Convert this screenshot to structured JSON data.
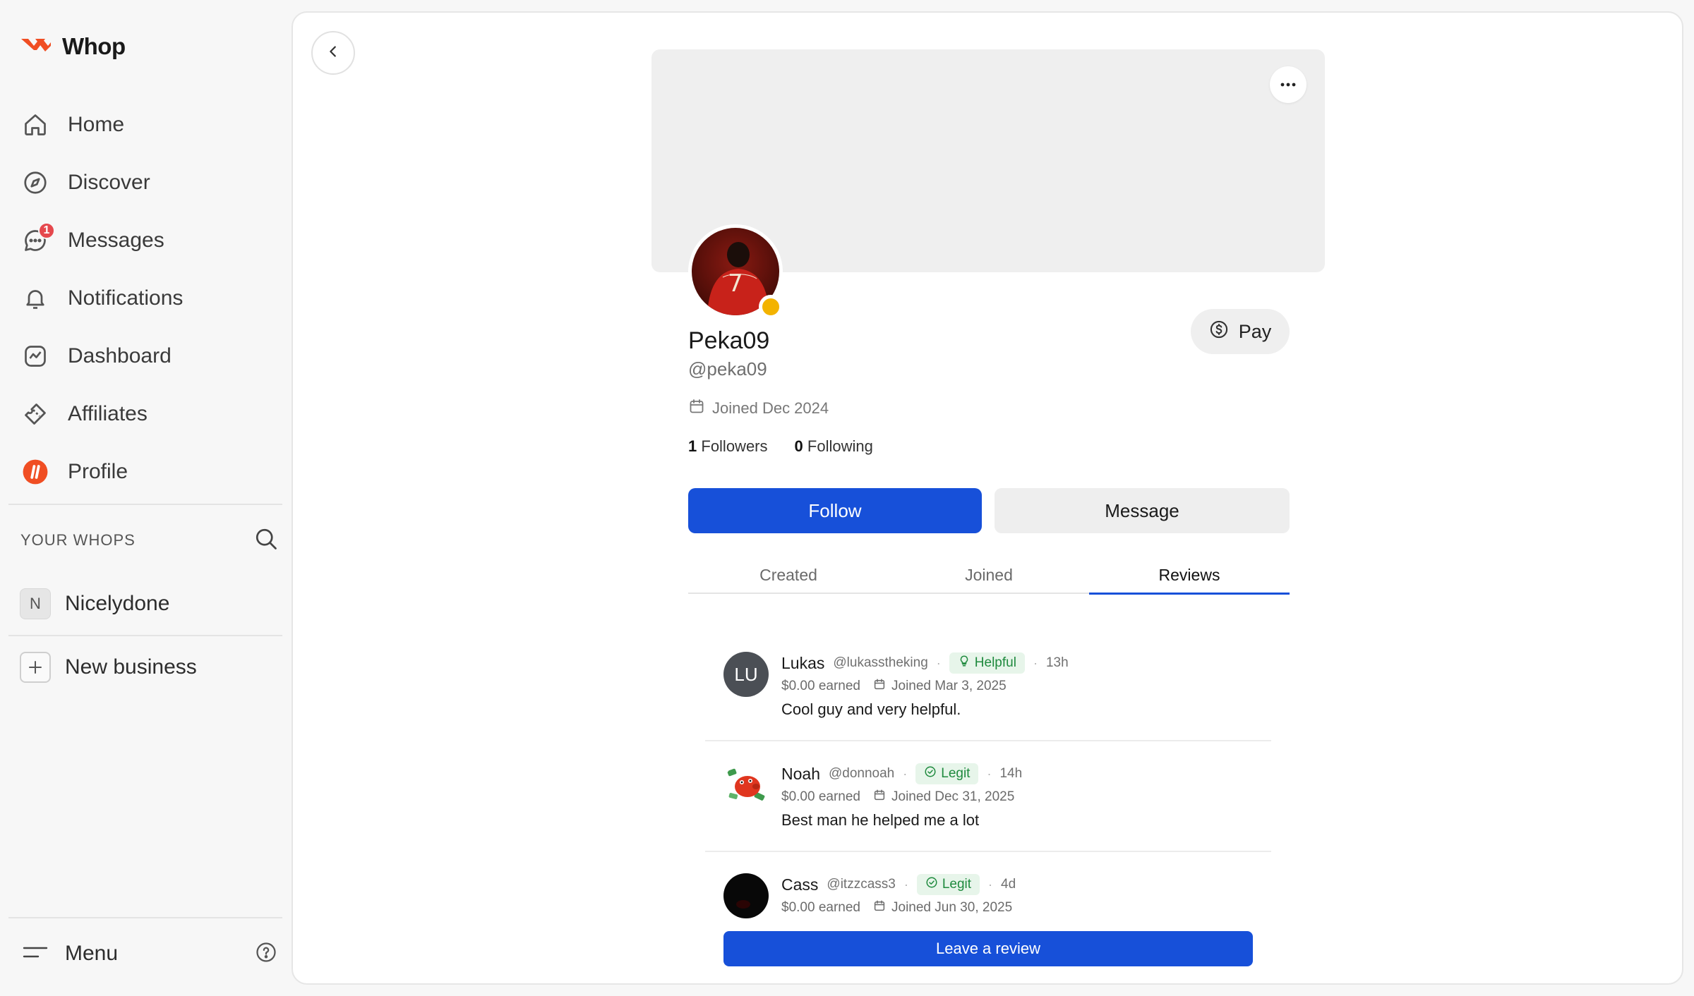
{
  "brand": {
    "name": "Whop",
    "accent": "#f04e23"
  },
  "sidebar": {
    "items": [
      {
        "label": "Home",
        "icon": "home-icon"
      },
      {
        "label": "Discover",
        "icon": "compass-icon"
      },
      {
        "label": "Messages",
        "icon": "chat-icon",
        "badge": "1"
      },
      {
        "label": "Notifications",
        "icon": "bell-icon"
      },
      {
        "label": "Dashboard",
        "icon": "chart-icon"
      },
      {
        "label": "Affiliates",
        "icon": "ticket-icon"
      },
      {
        "label": "Profile",
        "icon": "profile-logo-icon"
      }
    ],
    "section_title": "YOUR WHOPS",
    "whop": {
      "initial": "N",
      "name": "Nicelydone"
    },
    "new_business": "New business",
    "menu": "Menu"
  },
  "profile": {
    "display_name": "Peka09",
    "handle": "@peka09",
    "joined": "Joined Dec 2024",
    "followers_count": "1",
    "followers_label": "Followers",
    "following_count": "0",
    "following_label": "Following",
    "pay_label": "Pay",
    "follow_label": "Follow",
    "message_label": "Message",
    "status_color": "#f3b300"
  },
  "tabs": [
    "Created",
    "Joined",
    "Reviews"
  ],
  "active_tab": "Reviews",
  "reviews": [
    {
      "name": "Lukas",
      "handle": "@lukasstheking",
      "tag": "Helpful",
      "time": "13h",
      "earned": "$0.00 earned",
      "joined": "Joined Mar 3, 2025",
      "text": "Cool guy and very helpful.",
      "avatar_initials": "LU"
    },
    {
      "name": "Noah",
      "handle": "@donnoah",
      "tag": "Legit",
      "time": "14h",
      "earned": "$0.00 earned",
      "joined": "Joined Dec 31, 2025",
      "text": "Best man he helped me a lot"
    },
    {
      "name": "Cass",
      "handle": "@itzzcass3",
      "tag": "Legit",
      "time": "4d",
      "earned": "$0.00 earned",
      "joined": "Joined Jun 30, 2025",
      "text": ""
    }
  ],
  "leave_review_label": "Leave a review",
  "colors": {
    "primary": "#1750d9",
    "tag_bg": "#e7f5ea",
    "tag_fg": "#1f8a3e"
  }
}
